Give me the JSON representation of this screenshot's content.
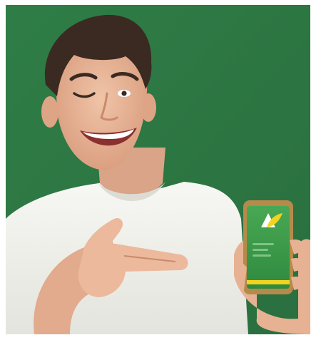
{
  "scene": {
    "background_color": "#2f7d46",
    "shirt_color": "#f2f2ee",
    "skin_color": "#e9b79a",
    "hair_color": "#3a2a22",
    "phone_frame_color": "#b58a4a",
    "phone_screen_color": "#3d9a4a",
    "app_accent_color": "#f2d320"
  },
  "icons": {
    "app_logo": "leaf-a-logo-icon"
  }
}
